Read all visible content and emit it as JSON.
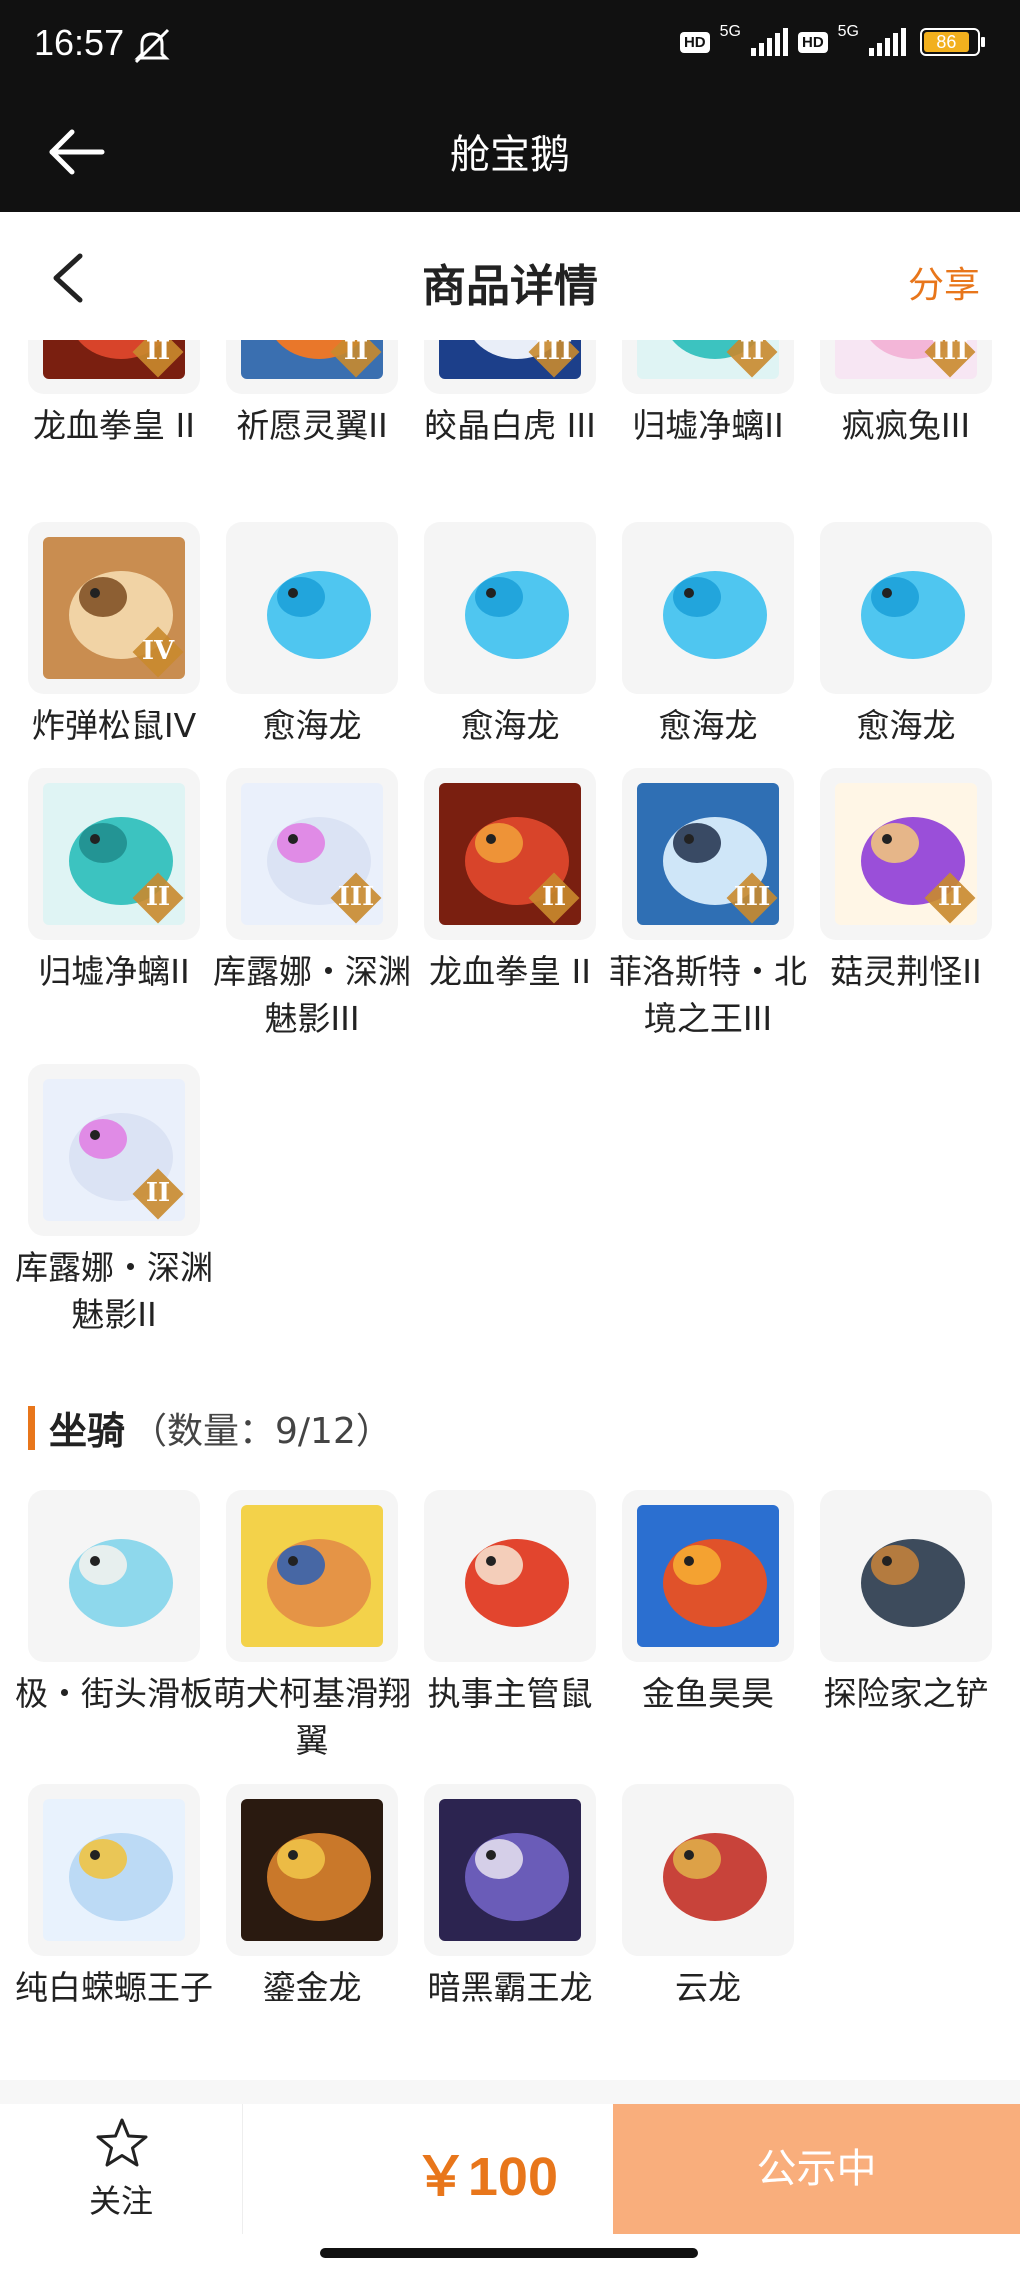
{
  "status_bar": {
    "time": "16:57",
    "network_1": "5G",
    "network_2": "5G",
    "hd_1": "HD",
    "hd_2": "HD",
    "battery": "86"
  },
  "app_header": {
    "title": "舱宝鹅"
  },
  "page_header": {
    "title": "商品详情",
    "share": "分享"
  },
  "items_top": [
    {
      "name": "龙血拳皇 II",
      "tier": "II",
      "icon": "red-dragon-boxer-art"
    },
    {
      "name": "祈愿灵翼II",
      "tier": "II",
      "icon": "eagle-art"
    },
    {
      "name": "皎晶白虎 III",
      "tier": "III",
      "icon": "white-tiger-art"
    },
    {
      "name": "归墟净螭II",
      "tier": "II",
      "icon": "teal-dragon-art"
    },
    {
      "name": "疯疯兔III",
      "tier": "III",
      "icon": "pink-rabbit-art"
    },
    {
      "name": "炸弹松鼠IV",
      "tier": "IV",
      "icon": "squirrel-art"
    },
    {
      "name": "愈海龙",
      "tier": "",
      "icon": "ice-dragon-art"
    },
    {
      "name": "愈海龙",
      "tier": "",
      "icon": "ice-dragon-art"
    },
    {
      "name": "愈海龙",
      "tier": "",
      "icon": "ice-dragon-art"
    },
    {
      "name": "愈海龙",
      "tier": "",
      "icon": "ice-dragon-art"
    },
    {
      "name": "归墟净螭II",
      "tier": "II",
      "icon": "teal-dragon-art"
    },
    {
      "name": "库露娜・深渊魅影III",
      "tier": "III",
      "icon": "white-hair-girl-art"
    },
    {
      "name": "龙血拳皇 II",
      "tier": "II",
      "icon": "red-dragon-boxer-art"
    },
    {
      "name": "菲洛斯特・北境之王III",
      "tier": "III",
      "icon": "frost-king-art"
    },
    {
      "name": "菇灵荆怪II",
      "tier": "II",
      "icon": "purple-elf-art"
    },
    {
      "name": "库露娜・深渊魅影II",
      "tier": "II",
      "icon": "white-hair-girl-art"
    }
  ],
  "mounts_section": {
    "label": "坐骑",
    "count": "（数量：9/12）"
  },
  "mounts": [
    {
      "name": "极・街头滑板",
      "icon": "skateboard-art"
    },
    {
      "name": "萌犬柯基滑翔翼",
      "icon": "corgi-glider-art"
    },
    {
      "name": "执事主管鼠",
      "icon": "butler-mouse-art"
    },
    {
      "name": "金鱼昊昊",
      "icon": "goldfish-art"
    },
    {
      "name": "探险家之铲",
      "icon": "shovel-art"
    },
    {
      "name": "纯白蝾螈王子",
      "icon": "axolotl-prince-art"
    },
    {
      "name": "鎏金龙",
      "icon": "golden-dragon-art"
    },
    {
      "name": "暗黑霸王龙",
      "icon": "dark-trex-art"
    },
    {
      "name": "云龙",
      "icon": "cloud-dragon-art"
    }
  ],
  "bottom_bar": {
    "follow_label": "关注",
    "price": "￥100",
    "status_button": "公示中"
  },
  "colors": {
    "accent": "#e8761b",
    "button": "#f9ae7c",
    "header": "#111111"
  }
}
